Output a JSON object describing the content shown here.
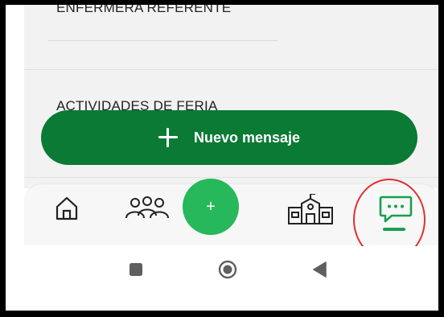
{
  "content": {
    "section_1_title": "ENFERMERA REFERENTE",
    "section_2_title": "ACTIVIDADES DE FERIA"
  },
  "fab": {
    "label": "Nuevo mensaje",
    "icon": "plus-icon",
    "color": "#0a7a34"
  },
  "bottom_nav": {
    "items": [
      {
        "icon": "home-icon"
      },
      {
        "icon": "users-group-icon"
      },
      {
        "icon": "plus-icon",
        "label": "+"
      },
      {
        "icon": "school-icon"
      },
      {
        "icon": "chat-icon",
        "active": true
      }
    ],
    "accent": "#18a050",
    "center_color": "#26b85a"
  },
  "system_nav": {
    "items": [
      "square-icon",
      "circle-icon",
      "back-triangle-icon"
    ]
  },
  "annotation": {
    "color": "#e03030"
  }
}
